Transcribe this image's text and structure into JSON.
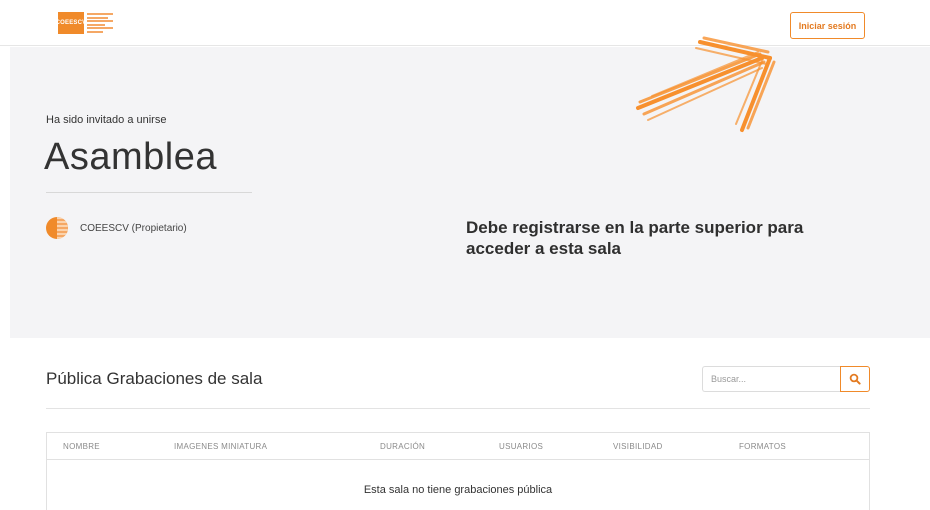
{
  "header": {
    "logo_text": "COEESCV",
    "login_label": "Iniciar sesión"
  },
  "room": {
    "invite_label": "Ha sido invitado a unirse",
    "name": "Asamblea",
    "owner": "COEESCV (Propietario)",
    "register_message": "Debe registrarse en la parte superior para acceder a esta sala"
  },
  "recordings": {
    "title": "Pública Grabaciones de sala",
    "search_placeholder": "Buscar...",
    "columns": [
      "NOMBRE",
      "IMAGENES MINIATURA",
      "DURACIÓN",
      "USUARIOS",
      "VISIBILIDAD",
      "FORMATOS"
    ],
    "empty_message": "Esta sala no tiene grabaciones pública"
  },
  "colors": {
    "accent": "#f08a2a",
    "hero_bg": "#f4f4f6",
    "arrow": "#f7902e"
  },
  "icons": {
    "search": "magnifier-icon",
    "arrow": "pointer-arrow-icon"
  }
}
